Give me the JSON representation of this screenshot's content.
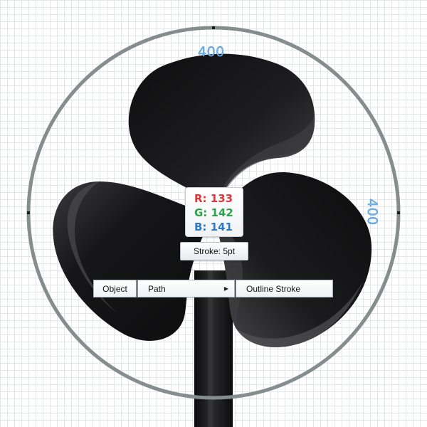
{
  "dimensions": {
    "width_label": "400",
    "height_label": "400"
  },
  "color_readout": {
    "r_label": "R:",
    "r_value": "133",
    "g_label": "G:",
    "g_value": "142",
    "b_label": "B:",
    "b_value": "141"
  },
  "stroke_tooltip": {
    "text": "Stroke: 5pt"
  },
  "context_menu": {
    "object_label": "Object",
    "path_label": "Path",
    "outline_stroke_label": "Outline Stroke"
  },
  "colors": {
    "ring_stroke": "#858e8d",
    "blade_dark": "#0f0f10",
    "blade_mid": "#2f2f31",
    "blade_light": "#505054",
    "stand": "#1a1a1b",
    "dimension_text": "#7ab7ec",
    "grid": "#e3e6ea"
  },
  "icons": {
    "submenu_arrow": "triangle-right-icon"
  }
}
